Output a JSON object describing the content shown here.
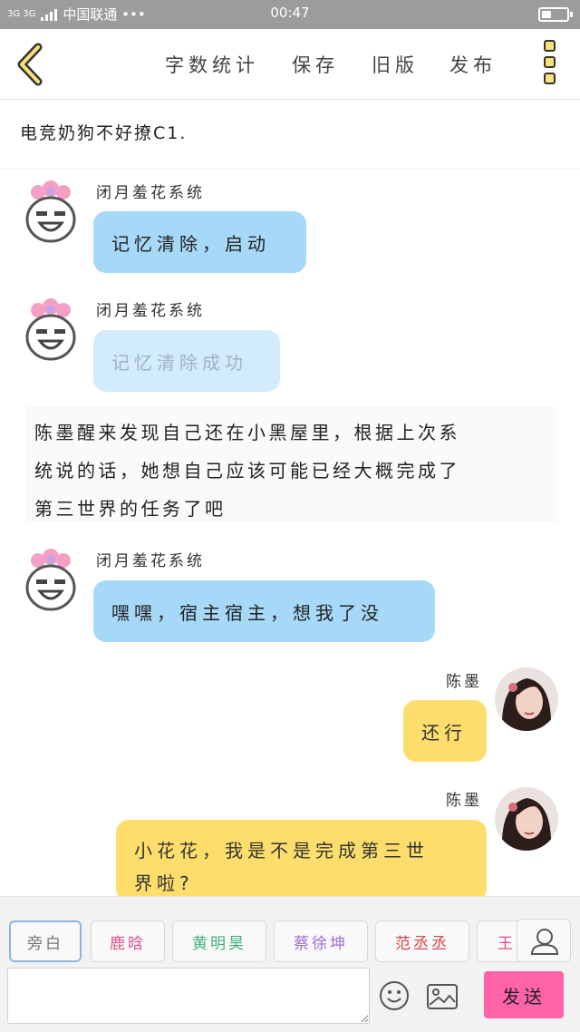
{
  "status_bar": {
    "network": "3G 3G",
    "carrier": "中国联通 •••",
    "time": "00:47"
  },
  "toolbar": {
    "items": [
      "字数统计",
      "保存",
      "旧版",
      "发布"
    ],
    "accent": "#f7e27a"
  },
  "story": {
    "title": "电竞奶狗不好撩C1."
  },
  "messages": [
    {
      "type": "bubble",
      "sender": "闭月羞花系统",
      "text": "记忆清除，启动",
      "style": "blue",
      "side": "left"
    },
    {
      "type": "bubble",
      "sender": "闭月羞花系统",
      "text": "记忆清除成功",
      "style": "pale",
      "side": "left"
    },
    {
      "type": "narration",
      "text": "陈墨醒来发现自己还在小黑屋里，根据上次系统说的话，她想自己应该可能已经大概完成了第三世界的任务了吧"
    },
    {
      "type": "bubble",
      "sender": "闭月羞花系统",
      "text": "嘿嘿，宿主宿主，想我了没",
      "style": "blue",
      "side": "left"
    },
    {
      "type": "bubble",
      "sender": "陈墨",
      "text": "还行",
      "style": "yellow",
      "side": "right"
    },
    {
      "type": "bubble",
      "sender": "陈墨",
      "text": "小花花，我是不是完成第三世界啦?",
      "style": "yellow",
      "side": "right"
    }
  ],
  "narration_line_1": "陈墨醒来发现自己还在小黑屋里，根据上次系",
  "narration_line_2": "统说的话，她想自己应该可能已经大概完成了",
  "narration_line_3": "第三世界的任务了吧",
  "last_bubble_line_1": "小花花，我是不是完成第三世",
  "last_bubble_line_2": "界啦?",
  "characters": [
    {
      "name": "旁白",
      "color": "#777777",
      "selected": true
    },
    {
      "name": "鹿晗",
      "color": "#e0508c"
    },
    {
      "name": "黄明昊",
      "color": "#3fb17a"
    },
    {
      "name": "蔡徐坤",
      "color": "#9b6fd6"
    },
    {
      "name": "范丞丞",
      "color": "#d64545"
    },
    {
      "name": "王",
      "color": "#e0508c"
    }
  ],
  "composer": {
    "input_value": "",
    "send_label": "发送",
    "send_color": "#ff63a8"
  },
  "colors": {
    "bubble_blue": "#a6d8f7",
    "bubble_pale": "#d3ecfb",
    "bubble_yellow": "#fdde6c"
  }
}
